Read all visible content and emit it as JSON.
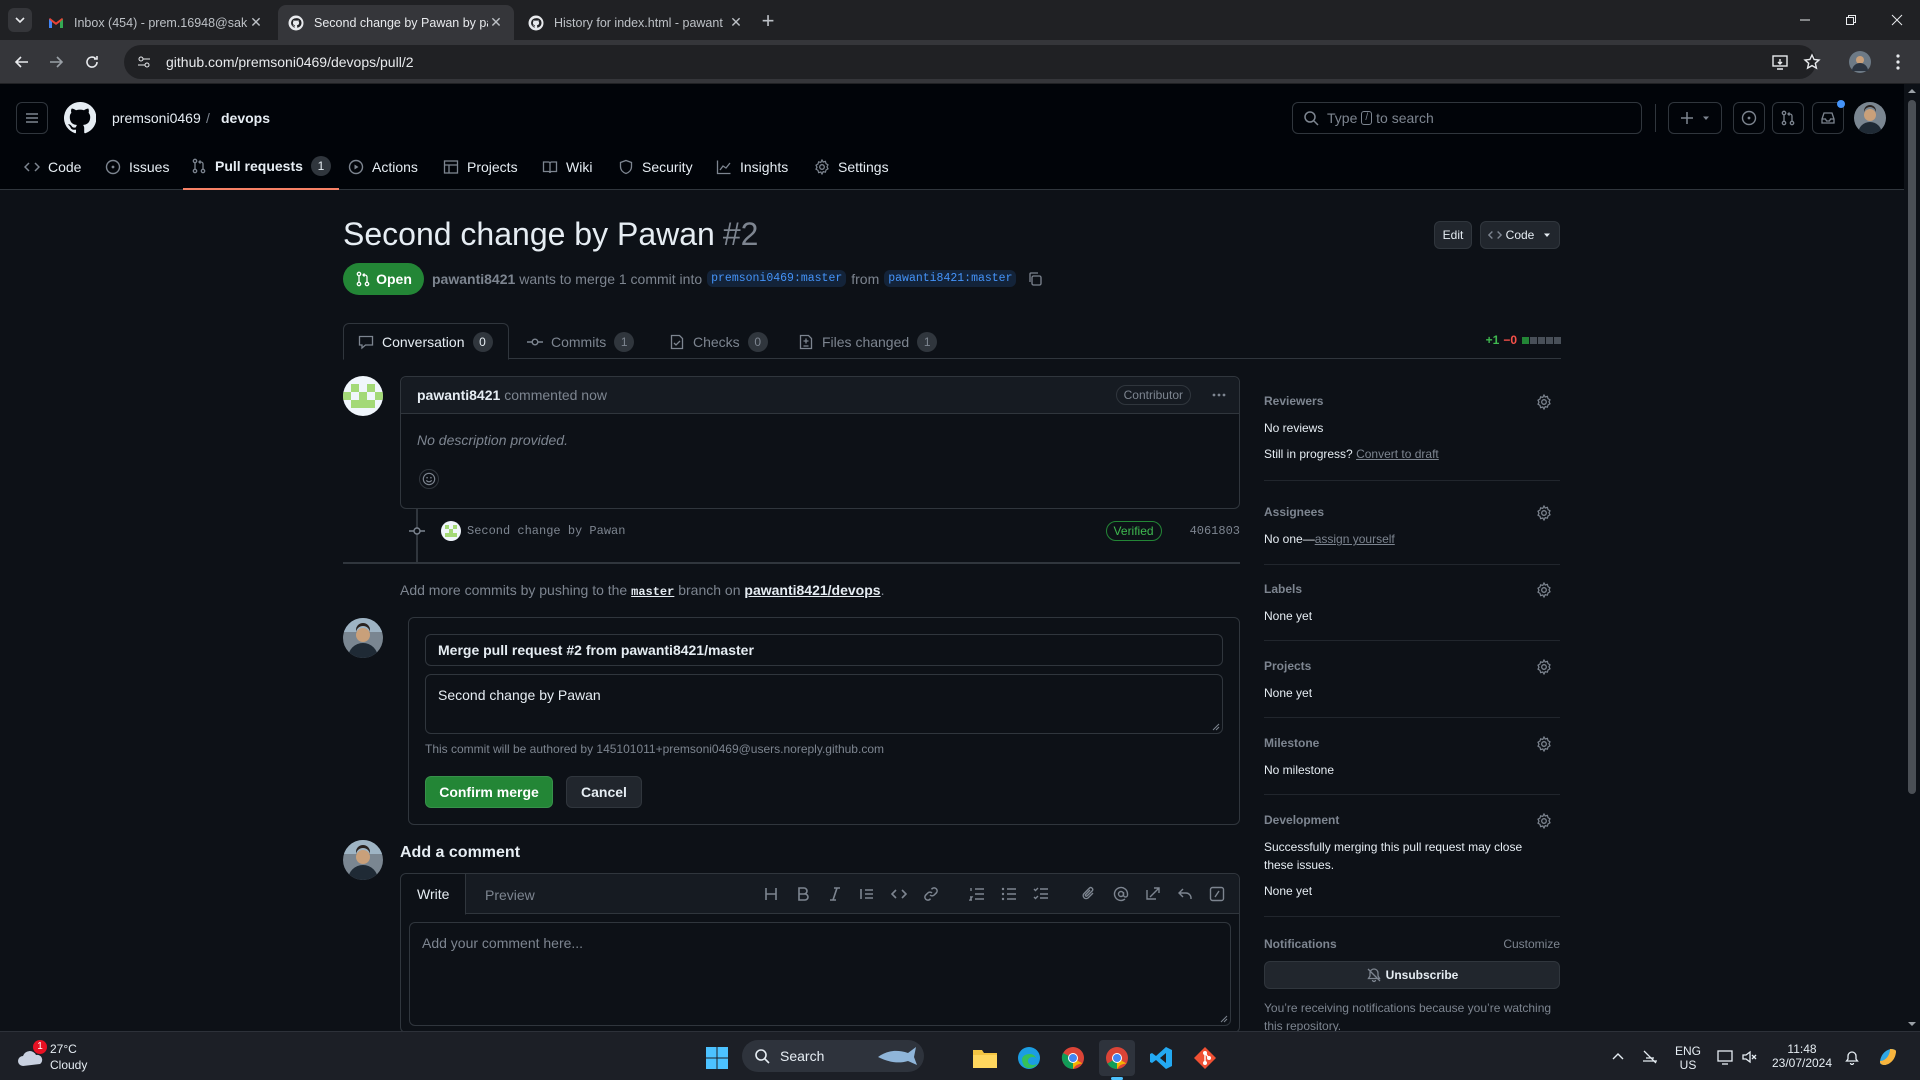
{
  "browser": {
    "tabs": [
      {
        "title": "Inbox (454) - prem.16948@sak",
        "icon": "gmail-icon",
        "active": false
      },
      {
        "title": "Second change by Pawan by pa",
        "icon": "github-icon",
        "active": true
      },
      {
        "title": "History for index.html - pawant",
        "icon": "github-icon",
        "active": false
      }
    ],
    "url": "github.com/premsoni0469/devops/pull/2"
  },
  "header": {
    "owner": "premsoni0469",
    "separator": "/",
    "repo": "devops",
    "search_prefix": "Type",
    "search_key": "/",
    "search_suffix": "to search"
  },
  "repo_nav": [
    {
      "label": "Code",
      "icon": "code-icon"
    },
    {
      "label": "Issues",
      "icon": "issue-icon"
    },
    {
      "label": "Pull requests",
      "icon": "pull-request-icon",
      "count": "1",
      "active": true
    },
    {
      "label": "Actions",
      "icon": "play-icon"
    },
    {
      "label": "Projects",
      "icon": "table-icon"
    },
    {
      "label": "Wiki",
      "icon": "book-icon"
    },
    {
      "label": "Security",
      "icon": "shield-icon"
    },
    {
      "label": "Insights",
      "icon": "graph-icon"
    },
    {
      "label": "Settings",
      "icon": "gear-icon"
    }
  ],
  "pr": {
    "title": "Second change by Pawan",
    "number": "#2",
    "edit_label": "Edit",
    "code_label": "Code",
    "state": "Open",
    "author": "pawanti8421",
    "meta_mid": "wants to merge 1 commit into",
    "base_branch": "premsoni0469:master",
    "from": "from",
    "head_branch": "pawanti8421:master",
    "tabs": [
      {
        "label": "Conversation",
        "count": "0",
        "icon": "comment-icon"
      },
      {
        "label": "Commits",
        "count": "1",
        "icon": "commit-icon"
      },
      {
        "label": "Checks",
        "count": "0",
        "icon": "checklist-icon"
      },
      {
        "label": "Files changed",
        "count": "1",
        "icon": "file-diff-icon"
      }
    ],
    "additions": "+1",
    "deletions": "−0",
    "diff_blocks": {
      "added": 1,
      "neutral": 4,
      "colors": {
        "added": "#238636",
        "neutral": "#484f58"
      }
    }
  },
  "comment": {
    "author": "pawanti8421",
    "action": "commented now",
    "role": "Contributor",
    "body": "No description provided."
  },
  "commit": {
    "message": "Second change by Pawan",
    "verified": "Verified",
    "sha": "4061803"
  },
  "hint": {
    "prefix": "Add more commits by pushing to the",
    "branch": "master",
    "mid": "branch on",
    "repo_link": "pawanti8421/devops",
    "suffix": "."
  },
  "merge": {
    "title_value": "Merge pull request #2 from pawanti8421/master",
    "body_value": "Second change by Pawan",
    "author_note": "This commit will be authored by 145101011+premsoni0469@users.noreply.github.com",
    "confirm_label": "Confirm merge",
    "cancel_label": "Cancel"
  },
  "add_comment": {
    "heading": "Add a comment",
    "write_tab": "Write",
    "preview_tab": "Preview",
    "placeholder": "Add your comment here..."
  },
  "sidebar": {
    "reviewers": {
      "heading": "Reviewers",
      "value": "No reviews",
      "draft_prefix": "Still in progress?",
      "draft_link": "Convert to draft"
    },
    "assignees": {
      "heading": "Assignees",
      "value_prefix": "No one—",
      "value_link": "assign yourself"
    },
    "labels": {
      "heading": "Labels",
      "value": "None yet"
    },
    "projects": {
      "heading": "Projects",
      "value": "None yet"
    },
    "milestone": {
      "heading": "Milestone",
      "value": "No milestone"
    },
    "development": {
      "heading": "Development",
      "text": "Successfully merging this pull request may close these issues.",
      "value": "None yet"
    },
    "notifications": {
      "heading": "Notifications",
      "customize": "Customize",
      "button": "Unsubscribe",
      "note": "You’re receiving notifications because you’re watching this repository."
    }
  },
  "taskbar": {
    "weather_temp": "27°C",
    "weather_desc": "Cloudy",
    "weather_badge": "1",
    "search_label": "Search",
    "lang_1": "ENG",
    "lang_2": "US",
    "time": "11:48",
    "date": "23/07/2024"
  }
}
